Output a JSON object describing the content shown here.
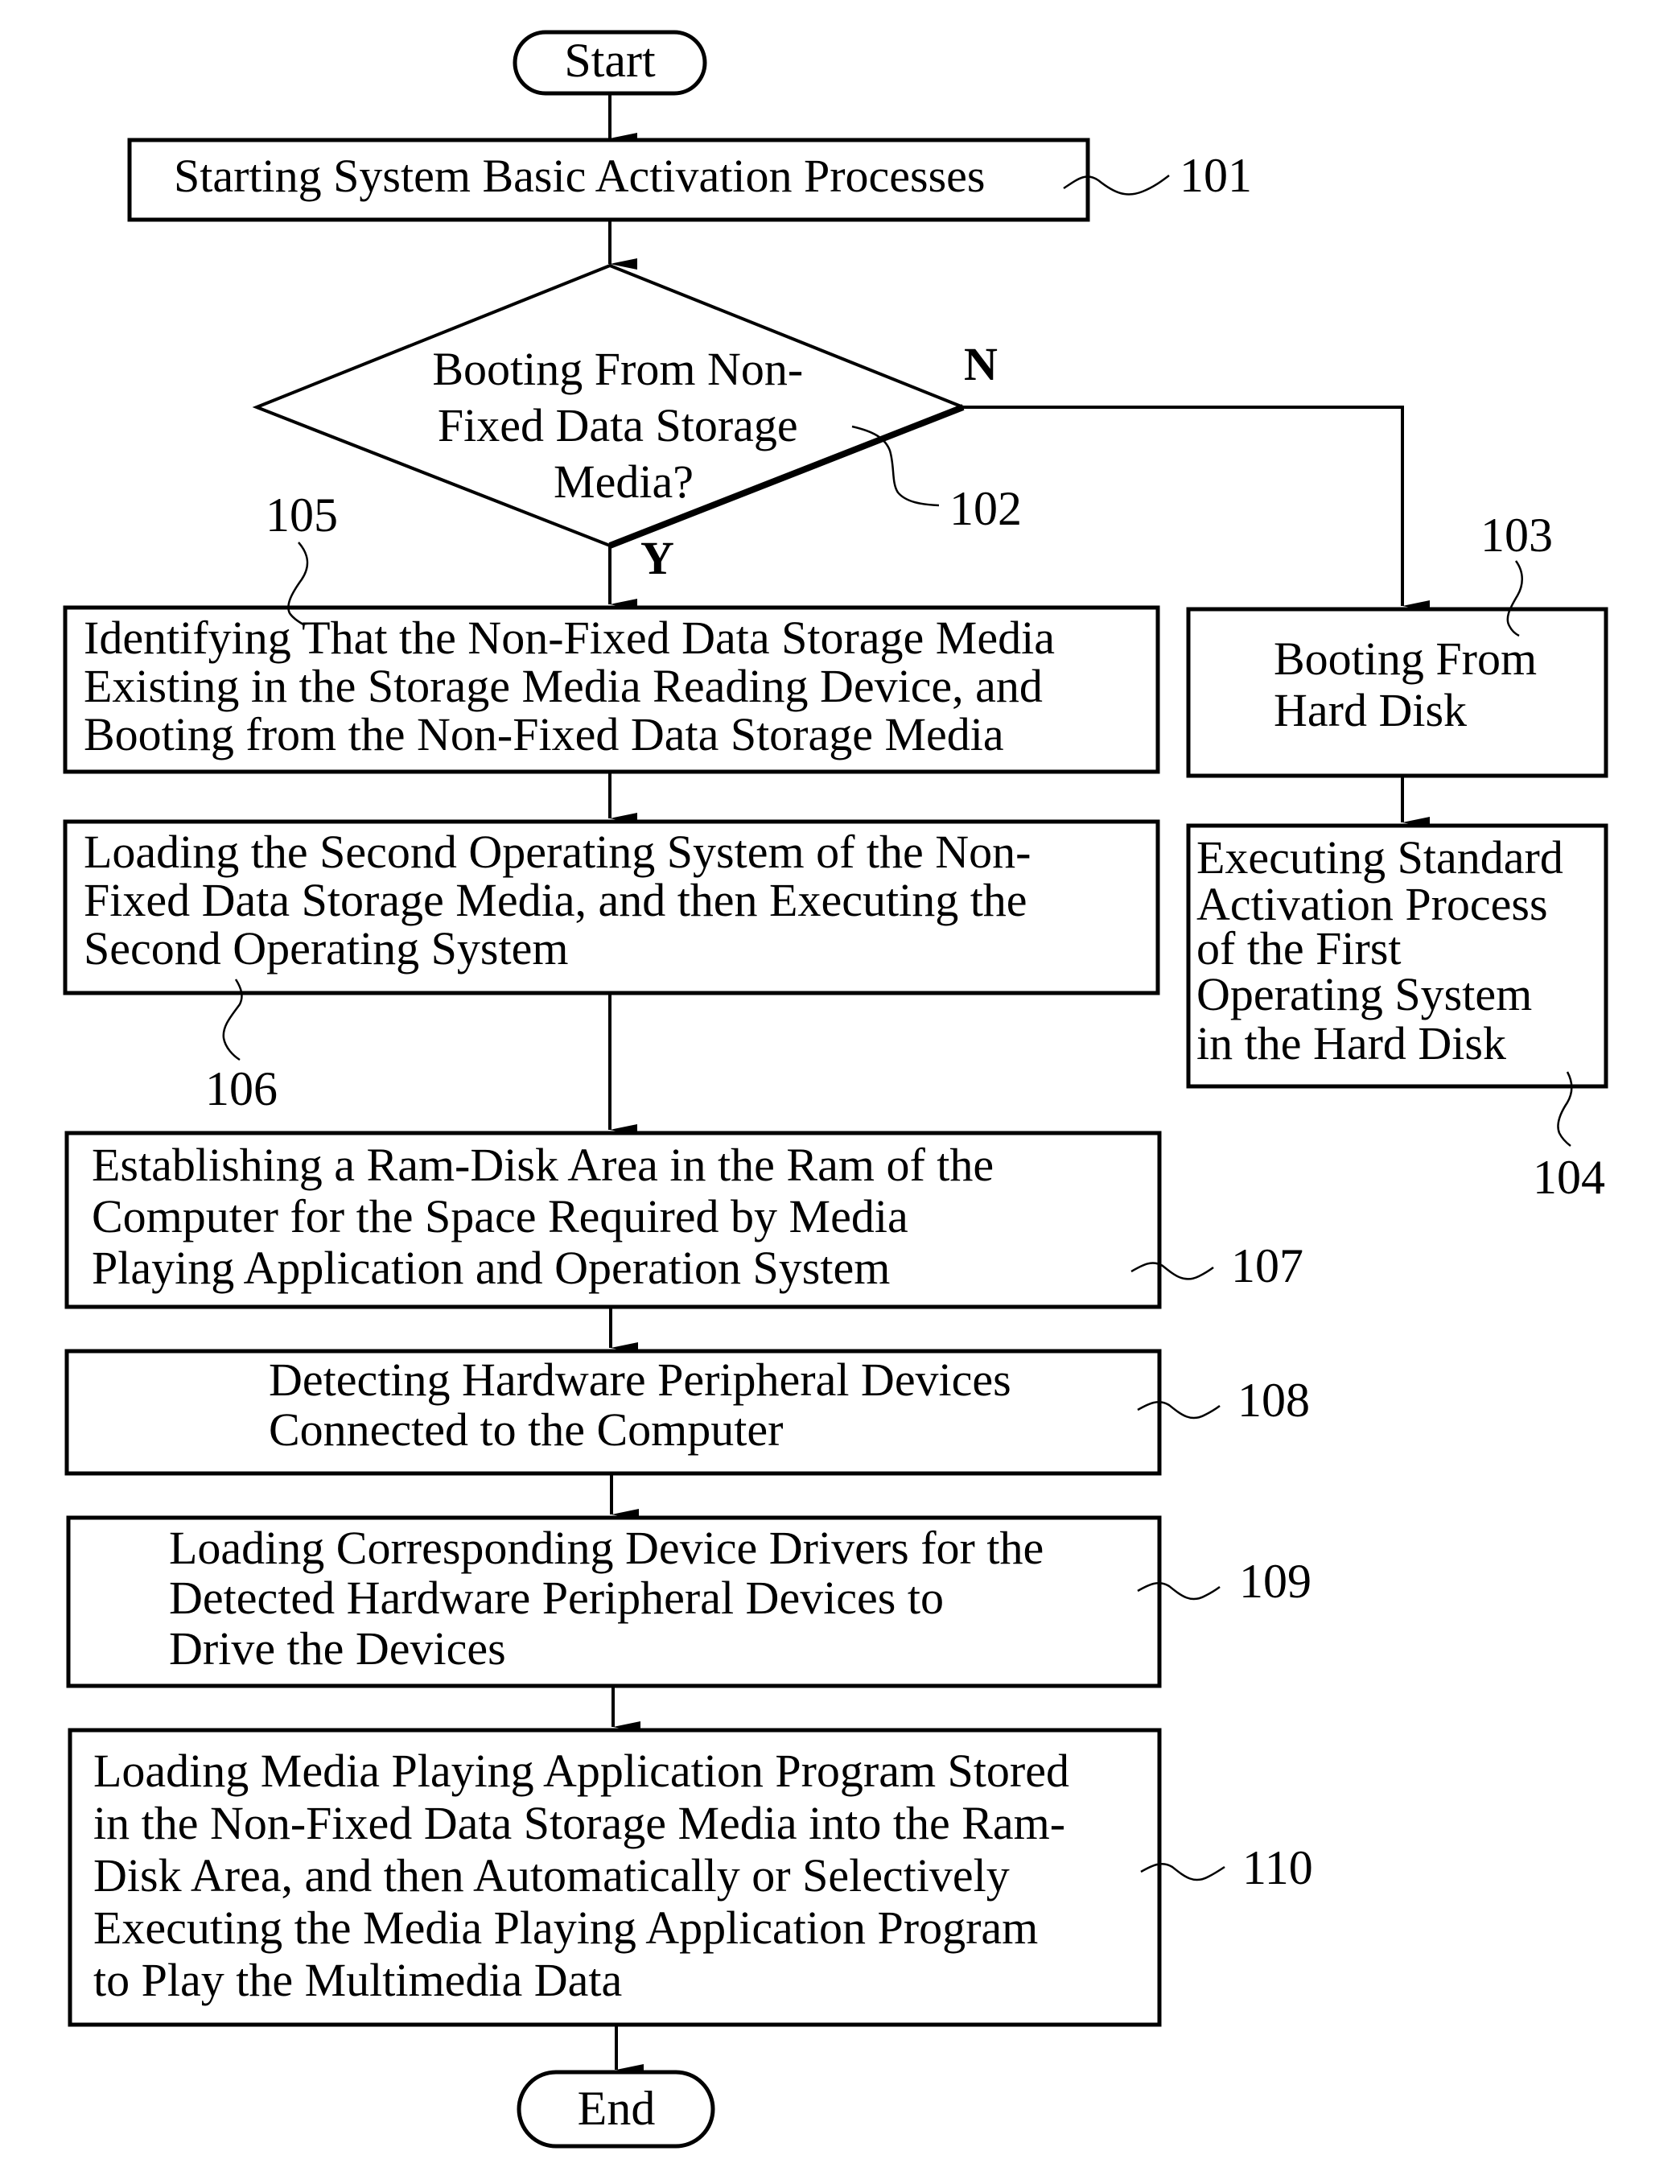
{
  "figure": {
    "type": "flowchart",
    "terminals": {
      "start": "Start",
      "end": "End"
    },
    "steps": [
      {
        "ref": "101",
        "lines": [
          "Starting System Basic Activation Processes"
        ]
      },
      {
        "ref": "102",
        "lines": [
          "Booting From Non-",
          "Fixed Data Storage",
          "Media?"
        ]
      },
      {
        "ref": "103",
        "lines": [
          "Booting From",
          "Hard Disk"
        ]
      },
      {
        "ref": "104",
        "lines": [
          "Executing Standard",
          "Activation Process",
          "of the First",
          "Operating System",
          "in the Hard Disk"
        ]
      },
      {
        "ref": "105",
        "lines": [
          "Identifying That the Non-Fixed Data Storage Media",
          "Existing in the Storage Media Reading Device, and",
          "Booting from the Non-Fixed Data Storage Media"
        ]
      },
      {
        "ref": "106",
        "lines": [
          "Loading the Second Operating System of the Non-",
          "Fixed Data Storage Media, and then Executing the",
          "Second Operating System"
        ]
      },
      {
        "ref": "107",
        "lines": [
          "Establishing a Ram-Disk Area in the Ram of the",
          "Computer for the Space Required by Media",
          "Playing Application and Operation System"
        ]
      },
      {
        "ref": "108",
        "lines": [
          "Detecting Hardware Peripheral Devices",
          "Connected to the Computer"
        ]
      },
      {
        "ref": "109",
        "lines": [
          "Loading Corresponding Device Drivers for the",
          "Detected Hardware Peripheral Devices to",
          "Drive the Devices"
        ]
      },
      {
        "ref": "110",
        "lines": [
          "Loading Media Playing Application Program Stored",
          "in the Non-Fixed Data Storage Media into the Ram-",
          "Disk Area, and then Automatically or Selectively",
          "Executing the Media Playing Application Program",
          "to Play the Multimedia Data"
        ]
      }
    ],
    "branch_labels": {
      "yes": "Y",
      "no": "N"
    }
  }
}
